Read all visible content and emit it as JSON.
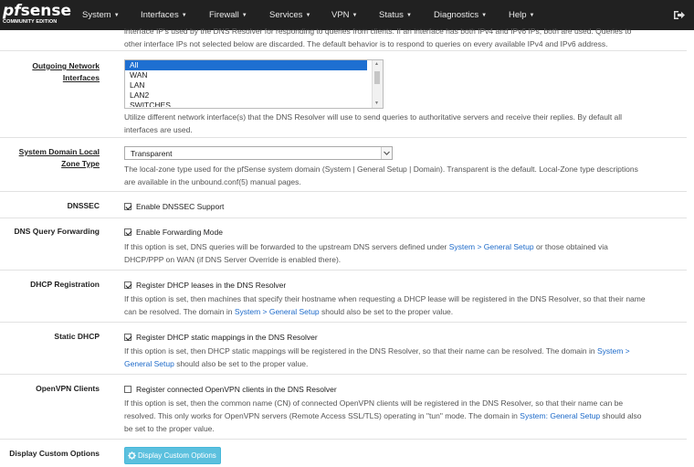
{
  "brand": {
    "name_pf": "pf",
    "name_rest": "sense",
    "edition": "COMMUNITY EDITION"
  },
  "nav": {
    "items": [
      "System",
      "Interfaces",
      "Firewall",
      "Services",
      "VPN",
      "Status",
      "Diagnostics",
      "Help"
    ],
    "logout_icon": "sign-out-icon"
  },
  "top_help": {
    "line1": "interface IP's used by the DNS Resolver for responding to queries from clients. If an interface has both IPv4 and IPv6 IPs, both are used. Queries to",
    "line2": "other interface IPs not selected below are discarded. The default behavior is to respond to queries on every available IPv4 and IPv6 address."
  },
  "outgoing": {
    "label_line1": "Outgoing Network",
    "label_line2": "Interfaces",
    "options": [
      "All",
      "WAN",
      "LAN",
      "LAN2",
      "SWITCHES"
    ],
    "selected": "All",
    "help_line1": "Utilize different network interface(s) that the DNS Resolver will use to send queries to authoritative servers and receive their replies. By default all",
    "help_line2": "interfaces are used."
  },
  "zone_type": {
    "label_line1": "System Domain Local",
    "label_line2": "Zone Type",
    "value": "Transparent",
    "help_line1": "The local-zone type used for the pfSense system domain (System | General Setup | Domain). Transparent is the default. Local-Zone type descriptions",
    "help_line2": "are available in the unbound.conf(5) manual pages."
  },
  "dnssec": {
    "label": "DNSSEC",
    "checkbox": "Enable DNSSEC Support",
    "checked": true
  },
  "forwarding": {
    "label": "DNS Query Forwarding",
    "checkbox": "Enable Forwarding Mode",
    "checked": true,
    "help_a": "If this option is set, DNS queries will be forwarded to the upstream DNS servers defined under ",
    "help_link": "System > General Setup",
    "help_b": " or those obtained via",
    "help_line2": "DHCP/PPP on WAN (if DNS Server Override is enabled there)."
  },
  "dhcp_reg": {
    "label": "DHCP Registration",
    "checkbox": "Register DHCP leases in the DNS Resolver",
    "checked": true,
    "help_line1": "If this option is set, then machines that specify their hostname when requesting a DHCP lease will be registered in the DNS Resolver, so that their name",
    "help_a": "can be resolved. The domain in ",
    "help_link": "System > General Setup",
    "help_b": " should also be set to the proper value."
  },
  "static_dhcp": {
    "label": "Static DHCP",
    "checkbox": "Register DHCP static mappings in the DNS Resolver",
    "checked": true,
    "help_a": "If this option is set, then DHCP static mappings will be registered in the DNS Resolver, so that their name can be resolved. The domain in ",
    "help_link1": "System >",
    "help_link2": "General Setup",
    "help_b": " should also be set to the proper value."
  },
  "openvpn": {
    "label": "OpenVPN Clients",
    "checkbox": "Register connected OpenVPN clients in the DNS Resolver",
    "checked": false,
    "help_line1": "If this option is set, then the common name (CN) of connected OpenVPN clients will be registered in the DNS Resolver, so that their name can be",
    "help_line2": "resolved. This only works for OpenVPN servers (Remote Access SSL/TLS) operating in \"tun\" mode. The domain in ",
    "help_link": "System: General Setup",
    "help_b": " should also",
    "help_line3": "be set to the proper value."
  },
  "custom": {
    "label": "Display Custom Options",
    "button": "Display Custom Options",
    "button_icon": "gear-icon"
  },
  "colors": {
    "navbar": "#212121",
    "link": "#1d6ac9",
    "info_button": "#5bc0de",
    "selected_option": "#1e6fd1"
  }
}
